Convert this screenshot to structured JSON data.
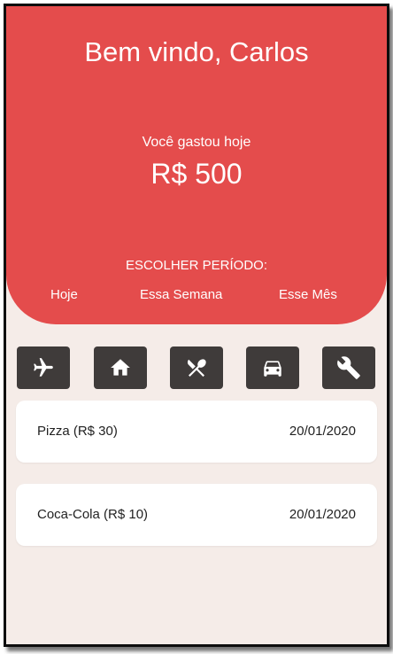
{
  "header": {
    "welcome": "Bem vindo, Carlos",
    "spent_label": "Você gastou hoje",
    "spent_value": "R$ 500",
    "period_title": "ESCOLHER PERÍODO:",
    "period_options": [
      "Hoje",
      "Essa Semana",
      "Esse Mês"
    ]
  },
  "categories": [
    {
      "icon": "airplane-icon"
    },
    {
      "icon": "home-icon"
    },
    {
      "icon": "restaurant-icon"
    },
    {
      "icon": "car-icon"
    },
    {
      "icon": "wrench-icon"
    }
  ],
  "expenses": [
    {
      "name": "Pizza (R$ 30)",
      "date": "20/01/2020"
    },
    {
      "name": "Coca-Cola (R$ 10)",
      "date": "20/01/2020"
    }
  ],
  "colors": {
    "accent": "#e44c4c",
    "background": "#f5ece8",
    "icon_button": "#3f3b3a",
    "card": "#ffffff"
  }
}
